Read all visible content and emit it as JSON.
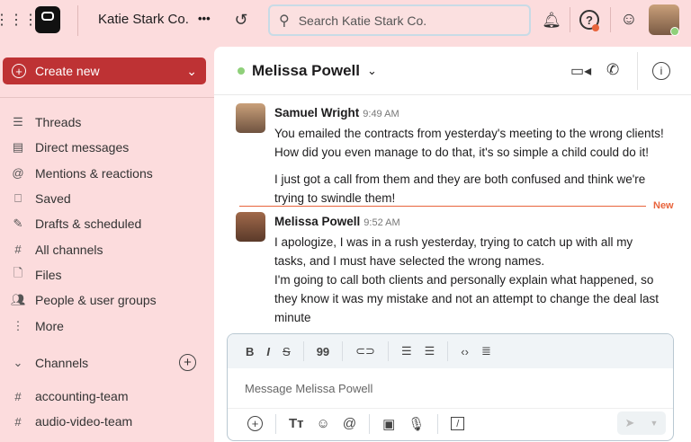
{
  "topbar": {
    "workspace": "Katie Stark Co.",
    "more": "•••",
    "search_placeholder": "Search Katie Stark Co."
  },
  "sidebar": {
    "create_label": "Create new",
    "items": [
      {
        "icon": "threads-icon",
        "label": "Threads"
      },
      {
        "icon": "direct-messages-icon",
        "label": "Direct messages"
      },
      {
        "icon": "mentions-icon",
        "label": "Mentions & reactions"
      },
      {
        "icon": "bookmark-icon",
        "label": "Saved"
      },
      {
        "icon": "drafts-icon",
        "label": "Drafts & scheduled"
      },
      {
        "icon": "channels-icon",
        "label": "All channels"
      },
      {
        "icon": "files-icon",
        "label": "Files"
      },
      {
        "icon": "people-icon",
        "label": "People & user groups"
      },
      {
        "icon": "more-icon",
        "label": "More"
      }
    ],
    "channels_label": "Channels",
    "channels": [
      "accounting-team",
      "audio-video-team"
    ]
  },
  "chat": {
    "title": "Melissa Powell",
    "new_label": "New",
    "messages": [
      {
        "author": "Samuel Wright",
        "time": "9:49 AM",
        "paragraphs": [
          "You emailed the contracts from yesterday's meeting to the wrong clients! How did you even manage to do that, it's so simple a child could do it!",
          "I just got a call from them and they are both confused and think we're trying to swindle them!"
        ]
      },
      {
        "author": "Melissa Powell",
        "time": "9:52 AM",
        "paragraphs": [
          "I apologize, I was in a rush yesterday, trying to catch up with all my tasks, and I must have selected the wrong names.",
          "I'm going to call both clients and personally explain what happened, so they know it was my mistake and not an attempt to change the deal last minute"
        ]
      }
    ]
  },
  "composer": {
    "placeholder": "Message Melissa Powell"
  },
  "colors": {
    "accent": "#be3234",
    "background": "#fcdcdd",
    "online": "#8fd07a",
    "new": "#e8643c"
  }
}
